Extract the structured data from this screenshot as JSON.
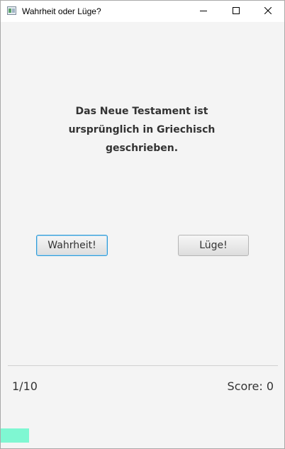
{
  "window": {
    "title": "Wahrheit oder Lüge?",
    "icon": "app-window-icon"
  },
  "titlebar_buttons": {
    "minimize_icon": "minimize-icon",
    "maximize_icon": "maximize-icon",
    "close_icon": "close-icon"
  },
  "quiz": {
    "question": "Das Neue Testament ist ursprünglich in Griechisch geschrieben.",
    "true_button_label": "Wahrheit!",
    "false_button_label": "Lüge!"
  },
  "footer": {
    "progress_label": "1/10",
    "score_label": "Score: 0",
    "current_question": 1,
    "total_questions": 10,
    "progress_fraction": 0.1,
    "progress_color": "#7ff7d2"
  },
  "colors": {
    "focus_border": "#2f9ad6",
    "background": "#f4f4f4"
  }
}
